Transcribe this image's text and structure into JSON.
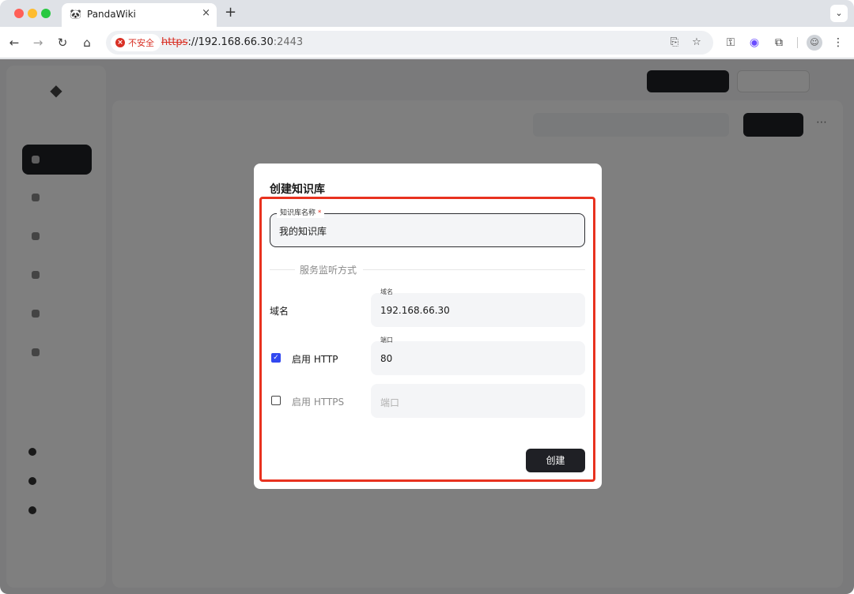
{
  "browser": {
    "tab_title": "PandaWiki",
    "tab_icon": "panda-icon",
    "close_glyph": "×",
    "newtab_glyph": "+",
    "insecure_label": "不安全",
    "url_scheme": "https",
    "url_host": "://192.168.66.30",
    "url_port": ":2443"
  },
  "modal": {
    "title": "创建知识库",
    "name_label": "知识库名称",
    "required_mark": "*",
    "name_value": "我的知识库",
    "section_title": "服务监听方式",
    "domain_row_label": "域名",
    "domain_small_label": "域名",
    "domain_value": "192.168.66.30",
    "http_label": "启用 HTTP",
    "http_checked": true,
    "http_port_small_label": "端口",
    "http_port_value": "80",
    "https_label": "启用 HTTPS",
    "https_checked": false,
    "https_port_placeholder": "端口",
    "create_button": "创建"
  },
  "colors": {
    "highlight": "#e8321f",
    "checkbox_accent": "#3248f0",
    "primary_button": "#1f2025",
    "insecure": "#d93025"
  }
}
